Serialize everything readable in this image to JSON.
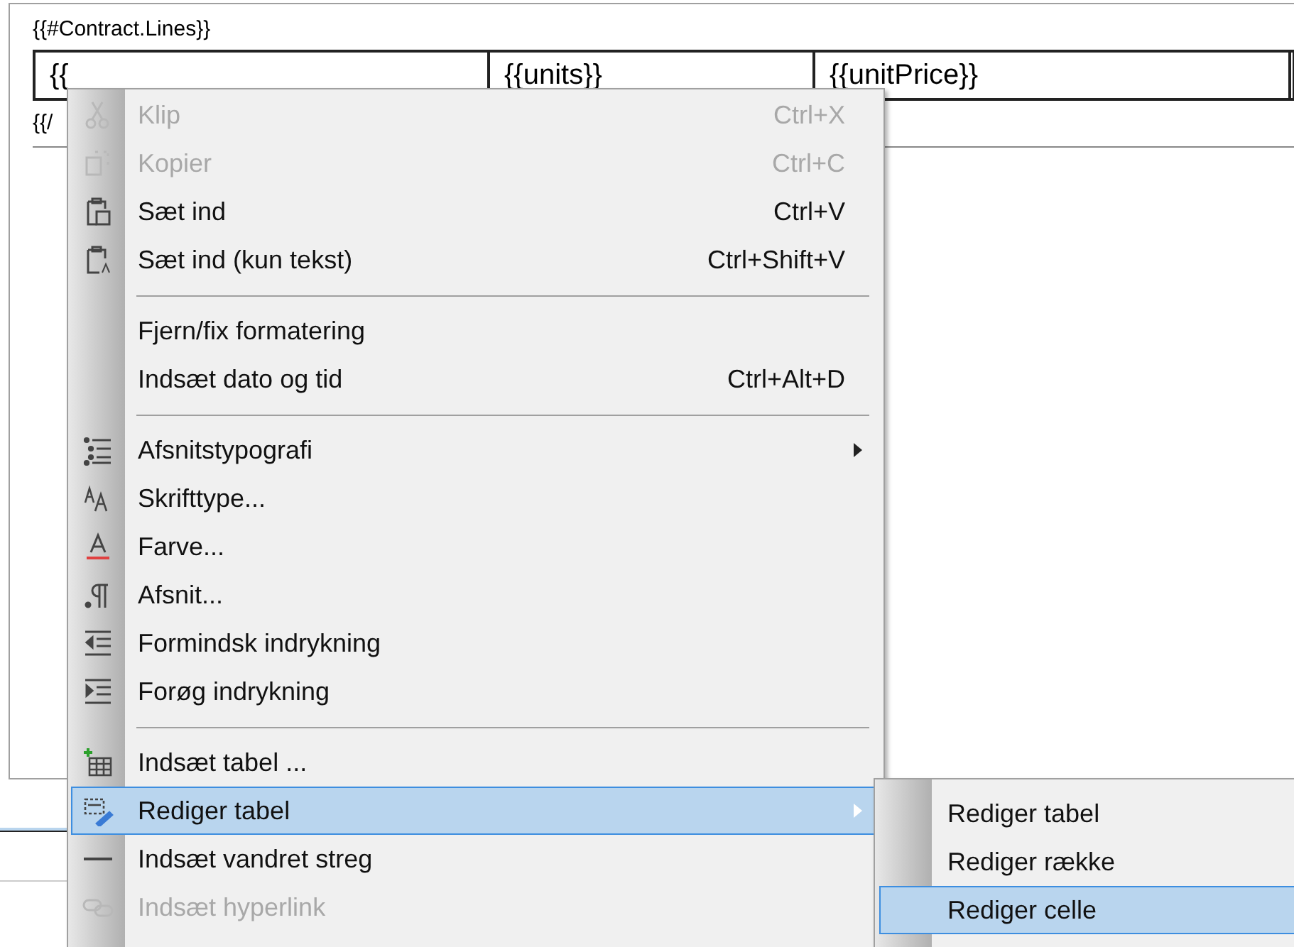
{
  "document": {
    "loop_start": "{{#Contract.Lines}}",
    "table_cells": [
      "{{",
      "{{units}}",
      "{{unitPrice}}"
    ],
    "loop_end": "{{/"
  },
  "context_menu": {
    "items": [
      {
        "kind": "item",
        "label": "Klip",
        "shortcut": "Ctrl+X",
        "disabled": true,
        "selected": false,
        "submenu": false
      },
      {
        "kind": "item",
        "label": "Kopier",
        "shortcut": "Ctrl+C",
        "disabled": true,
        "selected": false,
        "submenu": false
      },
      {
        "kind": "item",
        "label": "Sæt ind",
        "shortcut": "Ctrl+V",
        "disabled": false,
        "selected": false,
        "submenu": false
      },
      {
        "kind": "item",
        "label": "Sæt ind (kun tekst)",
        "shortcut": "Ctrl+Shift+V",
        "disabled": false,
        "selected": false,
        "submenu": false
      },
      {
        "kind": "separator"
      },
      {
        "kind": "item",
        "label": "Fjern/fix formatering",
        "disabled": false,
        "selected": false,
        "submenu": false
      },
      {
        "kind": "item",
        "label": "Indsæt dato og tid",
        "shortcut": "Ctrl+Alt+D",
        "disabled": false,
        "selected": false,
        "submenu": false
      },
      {
        "kind": "separator"
      },
      {
        "kind": "item",
        "label": "Afsnitstypografi",
        "disabled": false,
        "selected": false,
        "submenu": true
      },
      {
        "kind": "item",
        "label": "Skrifttype...",
        "disabled": false,
        "selected": false,
        "submenu": false
      },
      {
        "kind": "item",
        "label": "Farve...",
        "disabled": false,
        "selected": false,
        "submenu": false
      },
      {
        "kind": "item",
        "label": "Afsnit...",
        "disabled": false,
        "selected": false,
        "submenu": false
      },
      {
        "kind": "item",
        "label": "Formindsk indrykning",
        "disabled": false,
        "selected": false,
        "submenu": false
      },
      {
        "kind": "item",
        "label": "Forøg indrykning",
        "disabled": false,
        "selected": false,
        "submenu": false
      },
      {
        "kind": "separator"
      },
      {
        "kind": "item",
        "label": "Indsæt tabel ...",
        "disabled": false,
        "selected": false,
        "submenu": false
      },
      {
        "kind": "item",
        "label": "Rediger tabel",
        "disabled": false,
        "selected": true,
        "submenu": true
      },
      {
        "kind": "item",
        "label": "Indsæt vandret streg",
        "disabled": false,
        "selected": false,
        "submenu": false
      },
      {
        "kind": "item",
        "label": "Indsæt hyperlink",
        "disabled": true,
        "selected": false,
        "submenu": false
      }
    ]
  },
  "submenu": {
    "items": [
      {
        "label": "Rediger tabel",
        "selected": false
      },
      {
        "label": "Rediger række",
        "selected": false
      },
      {
        "label": "Rediger celle",
        "selected": true
      }
    ]
  }
}
